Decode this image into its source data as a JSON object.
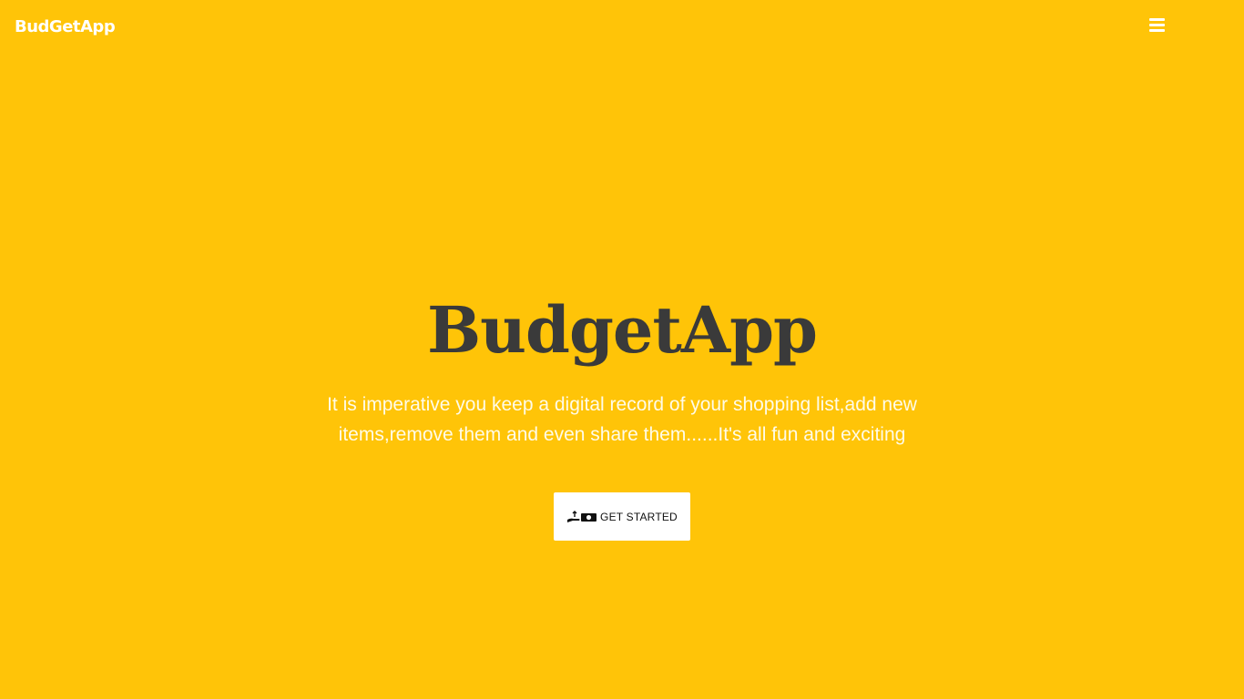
{
  "nav": {
    "brand": "BudGetApp",
    "menu_icon": "hamburger-menu-icon"
  },
  "hero": {
    "title": "BudgetApp",
    "description": "It is imperative you keep a digital record of your shopping list,add new items,remove them and even share them......It's all fun and exciting",
    "cta_label": "GET STARTED",
    "cta_icon": "hand-money-icon"
  },
  "colors": {
    "background": "#ffc408",
    "title": "#3a3a3a",
    "text": "#fffbe8",
    "button_bg": "#ffffff"
  }
}
